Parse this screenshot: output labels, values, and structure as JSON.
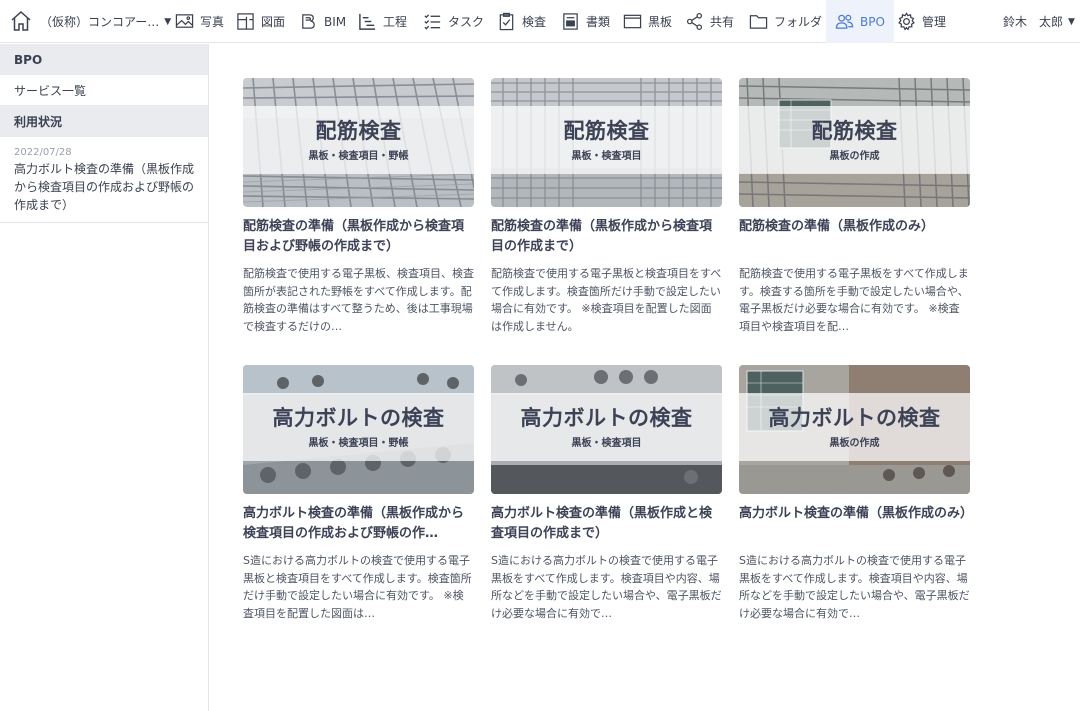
{
  "nav": {
    "project": "（仮称）コンコアー…",
    "items": [
      {
        "label": "写真",
        "icon": "photo-icon"
      },
      {
        "label": "図面",
        "icon": "drawing-icon"
      },
      {
        "label": "BIM",
        "icon": "bim-icon"
      },
      {
        "label": "工程",
        "icon": "gantt-icon"
      },
      {
        "label": "タスク",
        "icon": "task-list-icon"
      },
      {
        "label": "検査",
        "icon": "checklist-icon"
      },
      {
        "label": "書類",
        "icon": "document-icon"
      },
      {
        "label": "黒板",
        "icon": "blackboard-icon"
      },
      {
        "label": "共有",
        "icon": "share-icon"
      },
      {
        "label": "フォルダ",
        "icon": "folder-icon"
      },
      {
        "label": "BPO",
        "icon": "people-icon"
      },
      {
        "label": "管理",
        "icon": "gear-icon"
      }
    ],
    "user": "鈴木　太郎",
    "active_color": "#4a7ad9"
  },
  "sidebar": {
    "heading": "BPO",
    "service_list": "サービス一覧",
    "usage_heading": "利用状況",
    "news_date": "2022/07/28",
    "news_title": "高力ボルト検査の準備（黒板作成から検査項目の作成および野帳の作成まで）"
  },
  "cards": [
    {
      "band_title": "配筋検査",
      "band_sub": "黒板・検査項目・野帳",
      "title": "配筋検査の準備（黒板作成から検査項目および野帳の作成まで）",
      "desc": "配筋検査で使用する電子黒板、検査項目、検査箇所が表記された野帳をすべて作成します。配筋検査の準備はすべて整うため、後は工事現場で検査するだけの…"
    },
    {
      "band_title": "配筋検査",
      "band_sub": "黒板・検査項目",
      "title": "配筋検査の準備（黒板作成から検査項目の作成まで）",
      "desc": "配筋検査で使用する電子黒板と検査項目をすべて作成します。検査箇所だけ手動で設定したい場合に有効です。 ※検査項目を配置した図面は作成しません。"
    },
    {
      "band_title": "配筋検査",
      "band_sub": "黒板の作成",
      "title": "配筋検査の準備（黒板作成のみ）",
      "desc": "配筋検査で使用する電子黒板をすべて作成します。検査する箇所を手動で設定したい場合や、電子黒板だけ必要な場合に有効です。 ※検査項目や検査項目を配…"
    },
    {
      "band_title": "高力ボルトの検査",
      "band_sub": "黒板・検査項目・野帳",
      "title": "高力ボルト検査の準備（黒板作成から検査項目の作成および野帳の作…",
      "desc": "S造における高力ボルトの検査で使用する電子黒板と検査項目をすべて作成します。検査箇所だけ手動で設定したい場合に有効です。 ※検査項目を配置した図面は…"
    },
    {
      "band_title": "高力ボルトの検査",
      "band_sub": "黒板・検査項目",
      "title": "高力ボルト検査の準備（黒板作成と検査項目の作成まで）",
      "desc": "S造における高力ボルトの検査で使用する電子黒板をすべて作成します。検査項目や内容、場所などを手動で設定したい場合や、電子黒板だけ必要な場合に有効で…"
    },
    {
      "band_title": "高力ボルトの検査",
      "band_sub": "黒板の作成",
      "title": "高力ボルト検査の準備（黒板作成のみ）",
      "desc": "S造における高力ボルトの検査で使用する電子黒板をすべて作成します。検査項目や内容、場所などを手動で設定したい場合や、電子黒板だけ必要な場合に有効で…"
    }
  ]
}
